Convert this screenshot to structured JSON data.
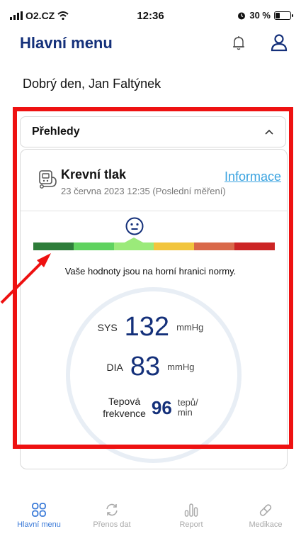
{
  "status": {
    "carrier": "O2.CZ",
    "time": "12:36",
    "battery": "30 %",
    "battery_level": 0.3
  },
  "header": {
    "title": "Hlavní menu"
  },
  "greeting": "Dobrý den, Jan Faltýnek",
  "overview": {
    "title": "Přehledy"
  },
  "blood_pressure": {
    "title": "Krevní tlak",
    "timestamp": "23 června 2023 12:35 (Poslední měření)",
    "info_link": "Informace",
    "message": "Vaše hodnoty jsou na horní hranici normy.",
    "scale_colors": [
      "#2e7d3a",
      "#5fd25f",
      "#9bea7a",
      "#f2c53d",
      "#d9694a",
      "#cc2424"
    ],
    "current_segment": 2,
    "sys_label": "SYS",
    "sys_value": "132",
    "sys_unit": "mmHg",
    "dia_label": "DIA",
    "dia_value": "83",
    "dia_unit": "mmHg",
    "hr_label_1": "Tepová",
    "hr_label_2": "frekvence",
    "hr_value": "96",
    "hr_unit_1": "tepů/",
    "hr_unit_2": "min"
  },
  "tabs": [
    {
      "label": "Hlavní menu",
      "active": true
    },
    {
      "label": "Přenos dat",
      "active": false
    },
    {
      "label": "Report",
      "active": false
    },
    {
      "label": "Medikace",
      "active": false
    }
  ],
  "colors": {
    "brand_dark": "#14307a",
    "link": "#3aa3e0",
    "highlight": "#ee1111",
    "tab_active": "#3a7ad8"
  }
}
